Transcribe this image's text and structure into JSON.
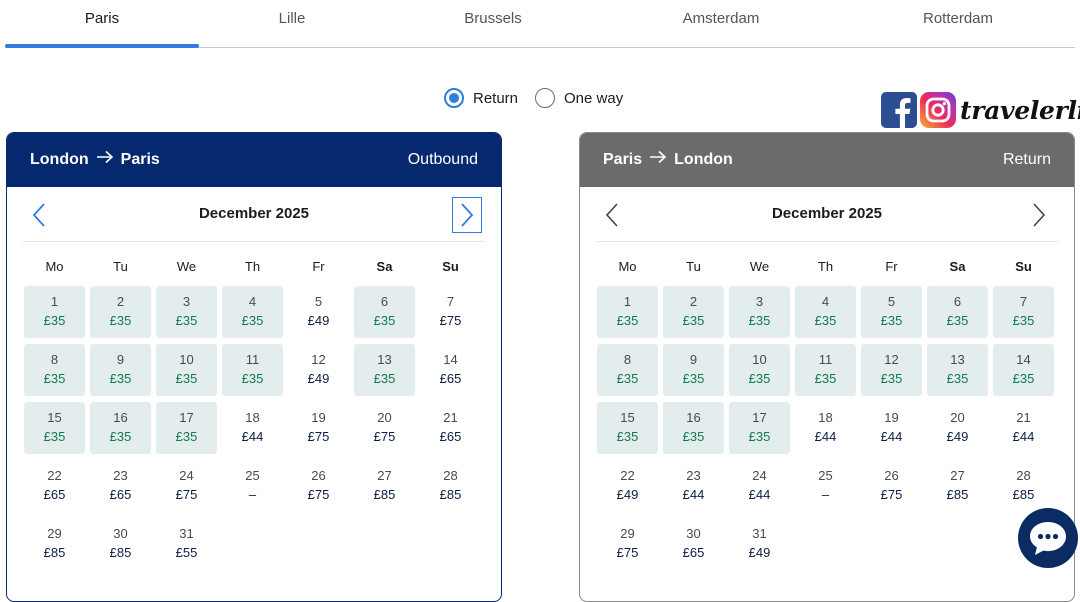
{
  "tabs": [
    {
      "label": "Paris",
      "active": true
    },
    {
      "label": "Lille",
      "active": false
    },
    {
      "label": "Brussels",
      "active": false
    },
    {
      "label": "Amsterdam",
      "active": false
    },
    {
      "label": "Rotterdam",
      "active": false
    }
  ],
  "trip_type": {
    "options": [
      {
        "label": "Return",
        "selected": true
      },
      {
        "label": "One way",
        "selected": false
      }
    ]
  },
  "watermark": {
    "text": "travelerliv",
    "icons": [
      "facebook-icon",
      "instagram-icon"
    ]
  },
  "weekdays": [
    "Mo",
    "Tu",
    "We",
    "Th",
    "Fr",
    "Sa",
    "Su"
  ],
  "colors": {
    "accent": "#2f7de1",
    "outbound_header": "#06286e",
    "return_header": "#6b6b6a",
    "low_fare_bg": "#e3eded",
    "low_fare_text": "#15794f"
  },
  "outbound": {
    "from": "London",
    "to": "Paris",
    "direction": "Outbound",
    "month": "December 2025",
    "days": [
      {
        "d": "1",
        "p": "£35",
        "low": true
      },
      {
        "d": "2",
        "p": "£35",
        "low": true
      },
      {
        "d": "3",
        "p": "£35",
        "low": true
      },
      {
        "d": "4",
        "p": "£35",
        "low": true
      },
      {
        "d": "5",
        "p": "£49",
        "low": false
      },
      {
        "d": "6",
        "p": "£35",
        "low": true
      },
      {
        "d": "7",
        "p": "£75",
        "low": false
      },
      {
        "d": "8",
        "p": "£35",
        "low": true
      },
      {
        "d": "9",
        "p": "£35",
        "low": true
      },
      {
        "d": "10",
        "p": "£35",
        "low": true
      },
      {
        "d": "11",
        "p": "£35",
        "low": true
      },
      {
        "d": "12",
        "p": "£49",
        "low": false
      },
      {
        "d": "13",
        "p": "£35",
        "low": true
      },
      {
        "d": "14",
        "p": "£65",
        "low": false
      },
      {
        "d": "15",
        "p": "£35",
        "low": true
      },
      {
        "d": "16",
        "p": "£35",
        "low": true
      },
      {
        "d": "17",
        "p": "£35",
        "low": true
      },
      {
        "d": "18",
        "p": "£44",
        "low": false
      },
      {
        "d": "19",
        "p": "£75",
        "low": false
      },
      {
        "d": "20",
        "p": "£75",
        "low": false
      },
      {
        "d": "21",
        "p": "£65",
        "low": false
      },
      {
        "d": "22",
        "p": "£65",
        "low": false
      },
      {
        "d": "23",
        "p": "£65",
        "low": false
      },
      {
        "d": "24",
        "p": "£75",
        "low": false
      },
      {
        "d": "25",
        "p": "–",
        "low": false
      },
      {
        "d": "26",
        "p": "£75",
        "low": false
      },
      {
        "d": "27",
        "p": "£85",
        "low": false
      },
      {
        "d": "28",
        "p": "£85",
        "low": false
      },
      {
        "d": "29",
        "p": "£85",
        "low": false
      },
      {
        "d": "30",
        "p": "£85",
        "low": false
      },
      {
        "d": "31",
        "p": "£55",
        "low": false
      }
    ]
  },
  "return": {
    "from": "Paris",
    "to": "London",
    "direction": "Return",
    "month": "December 2025",
    "days": [
      {
        "d": "1",
        "p": "£35",
        "low": true
      },
      {
        "d": "2",
        "p": "£35",
        "low": true
      },
      {
        "d": "3",
        "p": "£35",
        "low": true
      },
      {
        "d": "4",
        "p": "£35",
        "low": true
      },
      {
        "d": "5",
        "p": "£35",
        "low": true
      },
      {
        "d": "6",
        "p": "£35",
        "low": true
      },
      {
        "d": "7",
        "p": "£35",
        "low": true
      },
      {
        "d": "8",
        "p": "£35",
        "low": true
      },
      {
        "d": "9",
        "p": "£35",
        "low": true
      },
      {
        "d": "10",
        "p": "£35",
        "low": true
      },
      {
        "d": "11",
        "p": "£35",
        "low": true
      },
      {
        "d": "12",
        "p": "£35",
        "low": true
      },
      {
        "d": "13",
        "p": "£35",
        "low": true
      },
      {
        "d": "14",
        "p": "£35",
        "low": true
      },
      {
        "d": "15",
        "p": "£35",
        "low": true
      },
      {
        "d": "16",
        "p": "£35",
        "low": true
      },
      {
        "d": "17",
        "p": "£35",
        "low": true
      },
      {
        "d": "18",
        "p": "£44",
        "low": false
      },
      {
        "d": "19",
        "p": "£44",
        "low": false
      },
      {
        "d": "20",
        "p": "£49",
        "low": false
      },
      {
        "d": "21",
        "p": "£44",
        "low": false
      },
      {
        "d": "22",
        "p": "£49",
        "low": false
      },
      {
        "d": "23",
        "p": "£44",
        "low": false
      },
      {
        "d": "24",
        "p": "£44",
        "low": false
      },
      {
        "d": "25",
        "p": "–",
        "low": false
      },
      {
        "d": "26",
        "p": "£75",
        "low": false
      },
      {
        "d": "27",
        "p": "£85",
        "low": false
      },
      {
        "d": "28",
        "p": "£85",
        "low": false
      },
      {
        "d": "29",
        "p": "£75",
        "low": false
      },
      {
        "d": "30",
        "p": "£65",
        "low": false
      },
      {
        "d": "31",
        "p": "£49",
        "low": false
      }
    ]
  }
}
